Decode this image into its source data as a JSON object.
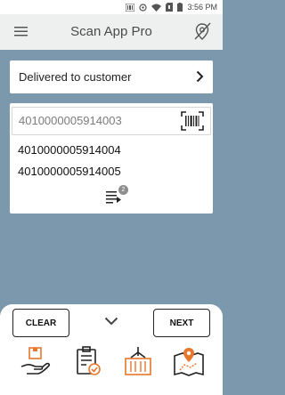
{
  "status_bar": {
    "time": "3:56 PM"
  },
  "app_bar": {
    "title": "Scan App Pro"
  },
  "status_select": {
    "value": "Delivered to customer"
  },
  "scan": {
    "current_value": "4010000005914003",
    "items": [
      "4010000005914004",
      "4010000005914005"
    ],
    "scanned_count": "2"
  },
  "actions": {
    "clear_label": "CLEAR",
    "next_label": "NEXT"
  },
  "steps": [
    "delivery-hand-icon",
    "checklist-icon",
    "container-crane-icon",
    "map-route-icon"
  ],
  "colors": {
    "background": "#7b98ad",
    "accent": "#e8762c"
  }
}
